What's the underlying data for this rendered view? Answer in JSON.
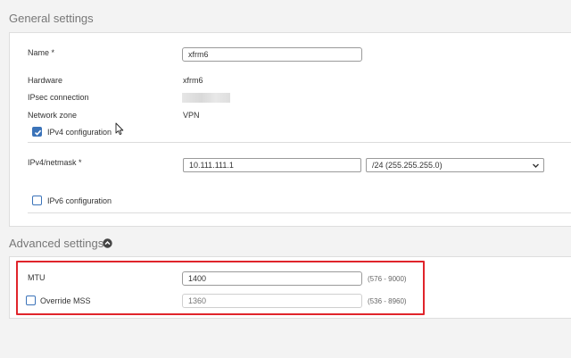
{
  "general": {
    "title": "General settings",
    "name_label": "Name *",
    "name_value": "xfrm6",
    "hardware_label": "Hardware",
    "hardware_value": "xfrm6",
    "ipsec_label": "IPsec connection",
    "zone_label": "Network zone",
    "zone_value": "VPN",
    "ipv4_config_label": "IPv4 configuration",
    "ipv4_config_checked": true,
    "ipv4_label": "IPv4/netmask *",
    "ipv4_value": "10.111.111.1",
    "netmask_value": "/24 (255.255.255.0)",
    "ipv6_config_label": "IPv6 configuration",
    "ipv6_config_checked": false
  },
  "advanced": {
    "title": "Advanced settings",
    "toggle_icon": "chevron-up-circle-icon",
    "mtu_label": "MTU",
    "mtu_value": "1400",
    "mtu_range": "(576 - 9000)",
    "mss_label": "Override MSS",
    "mss_checked": false,
    "mss_placeholder": "1360",
    "mss_range": "(536 - 8960)"
  },
  "colors": {
    "accent": "#3b73b9",
    "highlight": "#e0242b"
  }
}
